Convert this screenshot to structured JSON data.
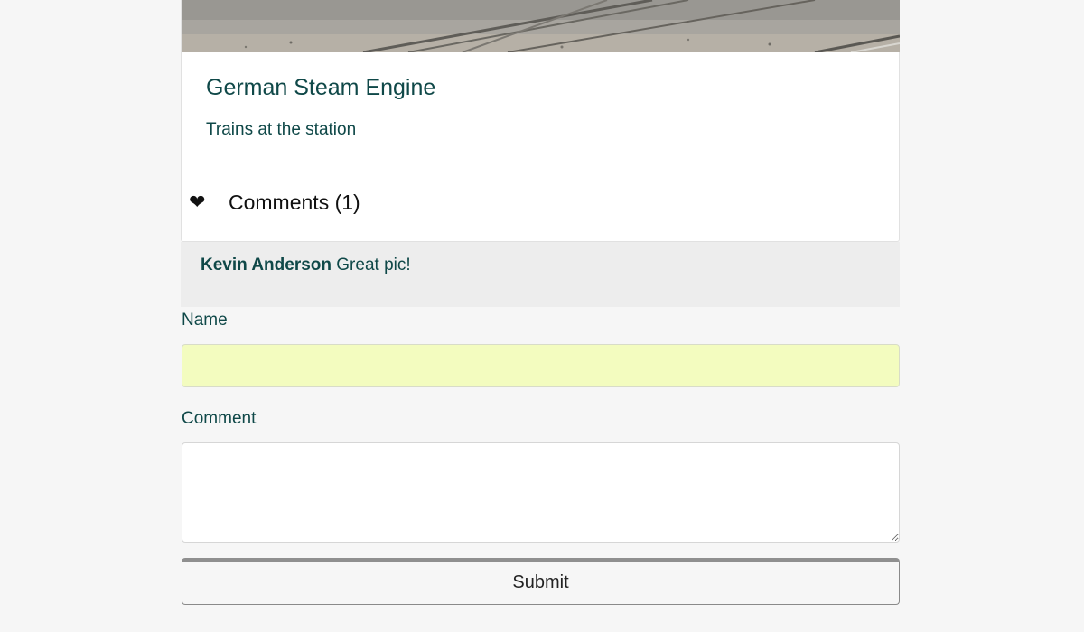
{
  "post": {
    "image_subject": "railway tracks",
    "title": "German Steam Engine",
    "caption": "Trains at the station"
  },
  "comments": {
    "icon": "heart-icon",
    "toggle_label": "Comments (1)",
    "items": [
      {
        "author": "Kevin Anderson",
        "text": "Great pic!"
      }
    ]
  },
  "form": {
    "name_label": "Name",
    "name_value": "",
    "comment_label": "Comment",
    "comment_value": "",
    "submit_label": "Submit"
  },
  "colors": {
    "page_background": "#f6f6f6",
    "text_teal": "#0f4848",
    "comment_background": "#ededed",
    "autofill_yellow": "#f3fcbf"
  }
}
